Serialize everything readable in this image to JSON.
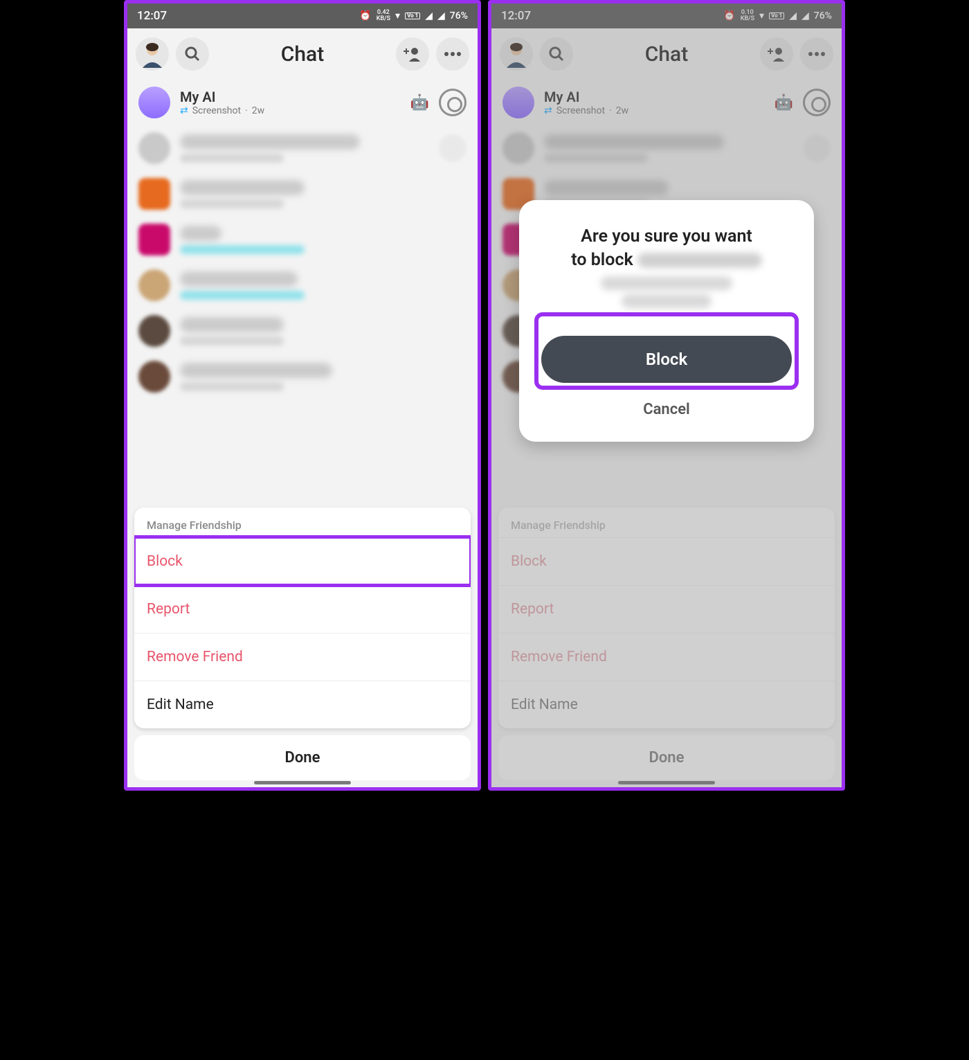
{
  "status": {
    "time": "12:07",
    "kbs_left": "0.42",
    "kbs_right": "0.10",
    "kbs_unit": "KB/S",
    "lte1": "LTE 1",
    "lte2": "LTE 2",
    "battery": "76%",
    "volte": "Vo 1"
  },
  "header": {
    "title": "Chat"
  },
  "chat": {
    "myai_name": "My AI",
    "myai_sub_action": "Screenshot",
    "myai_sub_time": "2w"
  },
  "sheet": {
    "title": "Manage Friendship",
    "block": "Block",
    "report": "Report",
    "remove": "Remove Friend",
    "edit": "Edit Name",
    "done": "Done"
  },
  "dialog": {
    "msg_line1": "Are you sure you want",
    "msg_line2_prefix": "to block",
    "block": "Block",
    "cancel": "Cancel"
  }
}
